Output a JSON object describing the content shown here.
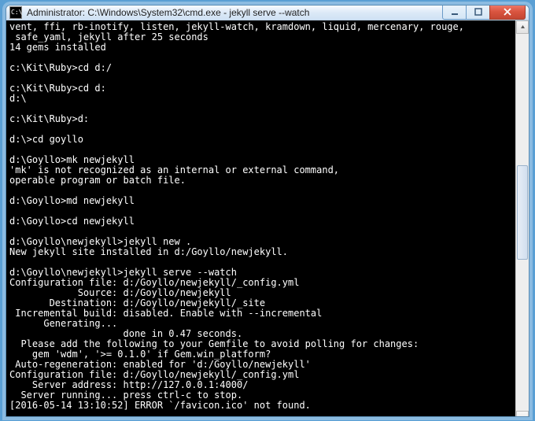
{
  "window": {
    "title": "Administrator: C:\\Windows\\System32\\cmd.exe - jekyll  serve --watch"
  },
  "console": {
    "lines": [
      "vent, ffi, rb-inotify, listen, jekyll-watch, kramdown, liquid, mercenary, rouge,",
      " safe_yaml, jekyll after 25 seconds",
      "14 gems installed",
      "",
      "c:\\Kit\\Ruby>cd d:/",
      "",
      "c:\\Kit\\Ruby>cd d:",
      "d:\\",
      "",
      "c:\\Kit\\Ruby>d:",
      "",
      "d:\\>cd goyllo",
      "",
      "d:\\Goyllo>mk newjekyll",
      "'mk' is not recognized as an internal or external command,",
      "operable program or batch file.",
      "",
      "d:\\Goyllo>md newjekyll",
      "",
      "d:\\Goyllo>cd newjekyll",
      "",
      "d:\\Goyllo\\newjekyll>jekyll new .",
      "New jekyll site installed in d:/Goyllo/newjekyll.",
      "",
      "d:\\Goyllo\\newjekyll>jekyll serve --watch",
      "Configuration file: d:/Goyllo/newjekyll/_config.yml",
      "            Source: d:/Goyllo/newjekyll",
      "       Destination: d:/Goyllo/newjekyll/_site",
      " Incremental build: disabled. Enable with --incremental",
      "      Generating...",
      "                    done in 0.47 seconds.",
      "  Please add the following to your Gemfile to avoid polling for changes:",
      "    gem 'wdm', '>= 0.1.0' if Gem.win_platform?",
      " Auto-regeneration: enabled for 'd:/Goyllo/newjekyll'",
      "Configuration file: d:/Goyllo/newjekyll/_config.yml",
      "    Server address: http://127.0.0.1:4000/",
      "  Server running... press ctrl-c to stop.",
      "[2016-05-14 13:10:52] ERROR `/favicon.ico' not found."
    ]
  }
}
